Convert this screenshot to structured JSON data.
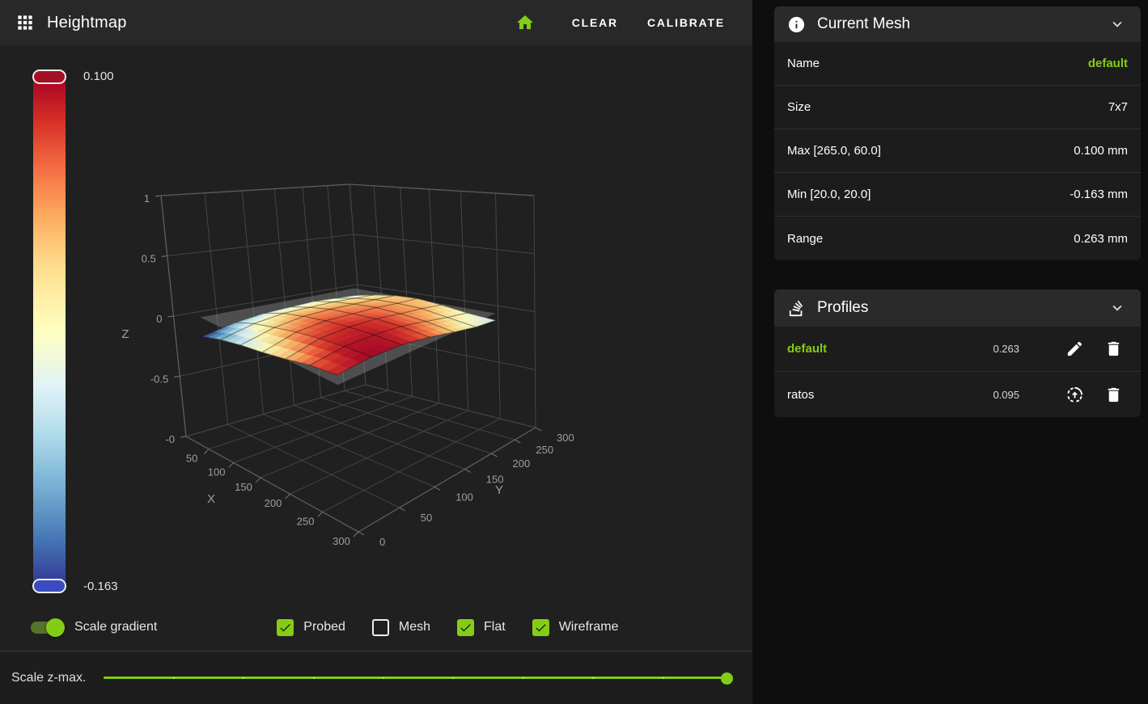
{
  "header": {
    "title": "Heightmap",
    "clear_label": "CLEAR",
    "calibrate_label": "CALIBRATE"
  },
  "colorbar": {
    "max_label": "0.100",
    "min_label": "-0.163"
  },
  "controls": {
    "scale_gradient": {
      "label": "Scale gradient",
      "on": true
    },
    "checkboxes": [
      {
        "id": "probed",
        "label": "Probed",
        "checked": true
      },
      {
        "id": "mesh",
        "label": "Mesh",
        "checked": false
      },
      {
        "id": "flat",
        "label": "Flat",
        "checked": true
      },
      {
        "id": "wireframe",
        "label": "Wireframe",
        "checked": true
      }
    ]
  },
  "scale_z": {
    "label": "Scale z-max.",
    "percent": 100
  },
  "current_mesh": {
    "title": "Current Mesh",
    "rows": [
      {
        "label": "Name",
        "value": "default",
        "highlight": true
      },
      {
        "label": "Size",
        "value": "7x7",
        "highlight": false
      },
      {
        "label": "Max [265.0, 60.0]",
        "value": "0.100 mm",
        "highlight": false
      },
      {
        "label": "Min [20.0, 20.0]",
        "value": "-0.163 mm",
        "highlight": false
      },
      {
        "label": "Range",
        "value": "0.263 mm",
        "highlight": false
      }
    ]
  },
  "profiles": {
    "title": "Profiles",
    "items": [
      {
        "name": "default",
        "range": "0.263",
        "active": true,
        "primary_action": "edit"
      },
      {
        "name": "ratos",
        "range": "0.095",
        "active": false,
        "primary_action": "load"
      }
    ]
  },
  "colors": {
    "accent": "#84cd16",
    "toggle_track": "#56732d",
    "check_mark": "#1e2a10"
  },
  "chart_data": {
    "type": "surface",
    "xlabel": "X",
    "ylabel": "Y",
    "zlabel": "Z",
    "x_ticks": [
      0,
      50,
      100,
      150,
      200,
      250,
      300
    ],
    "y_ticks": [
      0,
      50,
      100,
      150,
      200,
      250,
      300
    ],
    "z_tick_labels": [
      "1",
      "0.5",
      "0",
      "-0.5",
      "-0"
    ],
    "z_tick_values": [
      1,
      0.5,
      0,
      -0.5,
      -1
    ],
    "zlim": [
      -1,
      1
    ],
    "x": [
      20,
      61,
      102,
      143,
      184,
      224,
      265
    ],
    "y": [
      20,
      62,
      103,
      145,
      187,
      228,
      270
    ],
    "z_mm": [
      [
        -0.163,
        -0.11,
        -0.07,
        -0.04,
        0.0,
        0.05,
        0.08
      ],
      [
        -0.1,
        -0.04,
        0.0,
        0.04,
        0.07,
        0.09,
        0.1
      ],
      [
        -0.07,
        -0.01,
        0.03,
        0.06,
        0.08,
        0.09,
        0.09
      ],
      [
        -0.06,
        -0.01,
        0.03,
        0.05,
        0.07,
        0.07,
        0.05
      ],
      [
        -0.05,
        -0.01,
        0.02,
        0.04,
        0.04,
        0.03,
        0.0
      ],
      [
        -0.06,
        -0.02,
        0.01,
        0.02,
        0.02,
        -0.01,
        -0.04
      ],
      [
        -0.07,
        -0.03,
        0.0,
        0.01,
        -0.01,
        -0.04,
        -0.06
      ]
    ],
    "color_range": [
      -0.163,
      0.1
    ],
    "colorscale": "RdYlBu reversed",
    "flat_plane_z": 0,
    "wireframe": true,
    "grid": true
  }
}
